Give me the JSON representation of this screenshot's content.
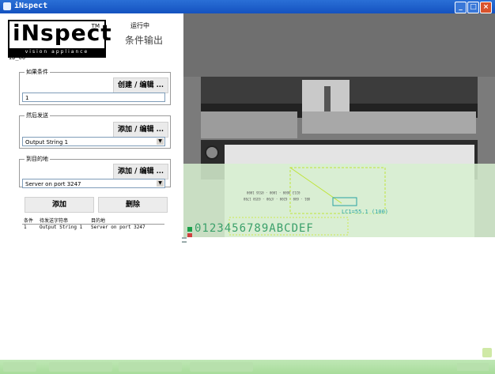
{
  "window": {
    "title": "iNspect"
  },
  "logo": {
    "wordmark": "iNspect",
    "tagline": "vision appliance",
    "tm": "TM"
  },
  "status": {
    "running": "运行中",
    "mode": "条件输出"
  },
  "identifier": "ID_00",
  "if_condition": {
    "legend": "如果条件",
    "button": "创建 / 编辑 ...",
    "value": "1"
  },
  "then_send": {
    "legend": "然后发送",
    "button": "添加 / 编辑 ...",
    "value": "Output String 1"
  },
  "to_destination": {
    "legend": "到目的地",
    "button": "添加 / 编辑 ...",
    "value": "Server on port 3247"
  },
  "actions": {
    "add": "添加",
    "delete": "删除"
  },
  "table": {
    "columns": [
      "条件",
      "待发送字符串",
      "目的地"
    ],
    "rows": [
      {
        "condition": "1",
        "string": "Output String 1",
        "destination": "Server on port 3247"
      }
    ]
  },
  "image_view": {
    "barcode_text": "0123456789ABCDEF",
    "measure_label": "LC1=55.1 (100)",
    "small_text_1": "0213 4600 - 1000 - 0516 1000",
    "small_text_2": "UB1 - 600 - 6200 - 4700 - 0350 1780"
  }
}
